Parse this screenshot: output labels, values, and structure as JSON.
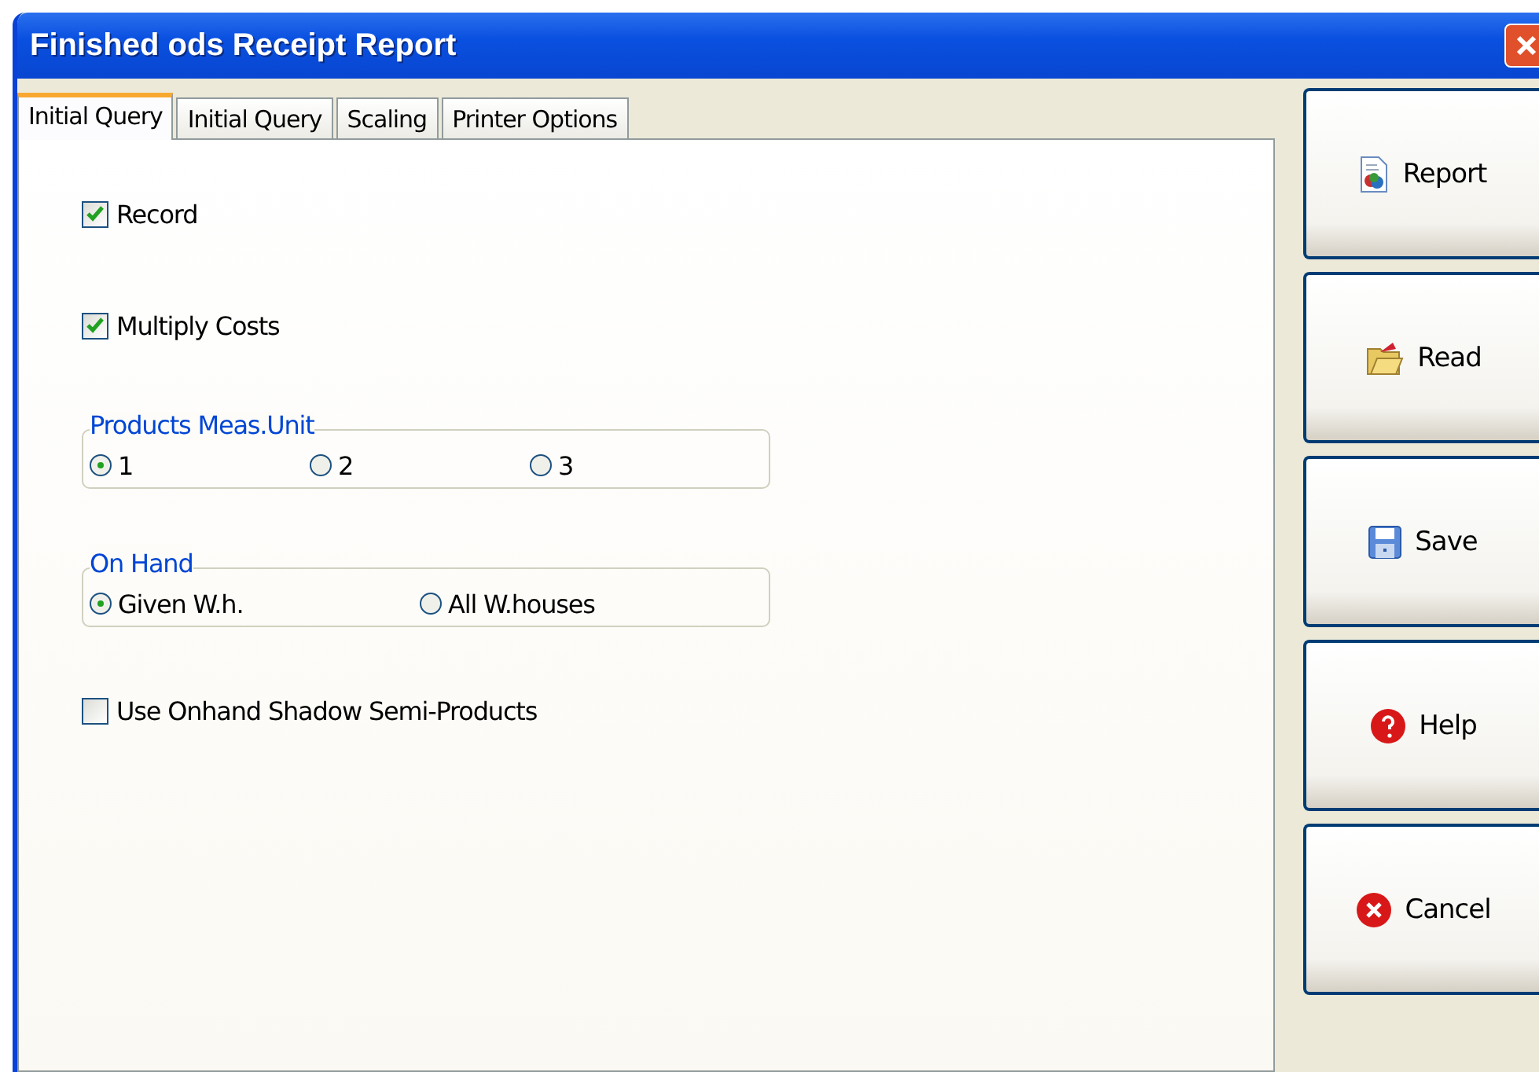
{
  "window": {
    "title": "Finished ods Receipt Report"
  },
  "tabs": [
    {
      "label": "Initial Query",
      "selected": true
    },
    {
      "label": "Initial Query",
      "selected": false
    },
    {
      "label": "Scaling",
      "selected": false
    },
    {
      "label": "Printer Options",
      "selected": false
    }
  ],
  "options": [
    {
      "kind": "checkbox",
      "label": "Record",
      "checked": true
    },
    {
      "kind": "checkbox",
      "label": "Multiply Costs",
      "checked": true
    },
    {
      "kind": "group",
      "title": "Products Meas.Unit",
      "radios": [
        {
          "label": "1",
          "selected": true
        },
        {
          "label": "2",
          "selected": false
        },
        {
          "label": "3",
          "selected": false
        }
      ]
    },
    {
      "kind": "group",
      "title": "On Hand",
      "radios": [
        {
          "label": "Given W.h.",
          "selected": true
        },
        {
          "label": "All W.houses",
          "selected": false
        }
      ]
    },
    {
      "kind": "checkbox",
      "label": "Use Onhand Shadow Semi-Products",
      "checked": false
    }
  ],
  "buttons": [
    {
      "kind": "report",
      "label": "Report"
    },
    {
      "kind": "read",
      "label": "Read"
    },
    {
      "kind": "save",
      "label": "Save"
    },
    {
      "kind": "help",
      "label": "Help"
    },
    {
      "kind": "cancel",
      "label": "Cancel"
    }
  ]
}
